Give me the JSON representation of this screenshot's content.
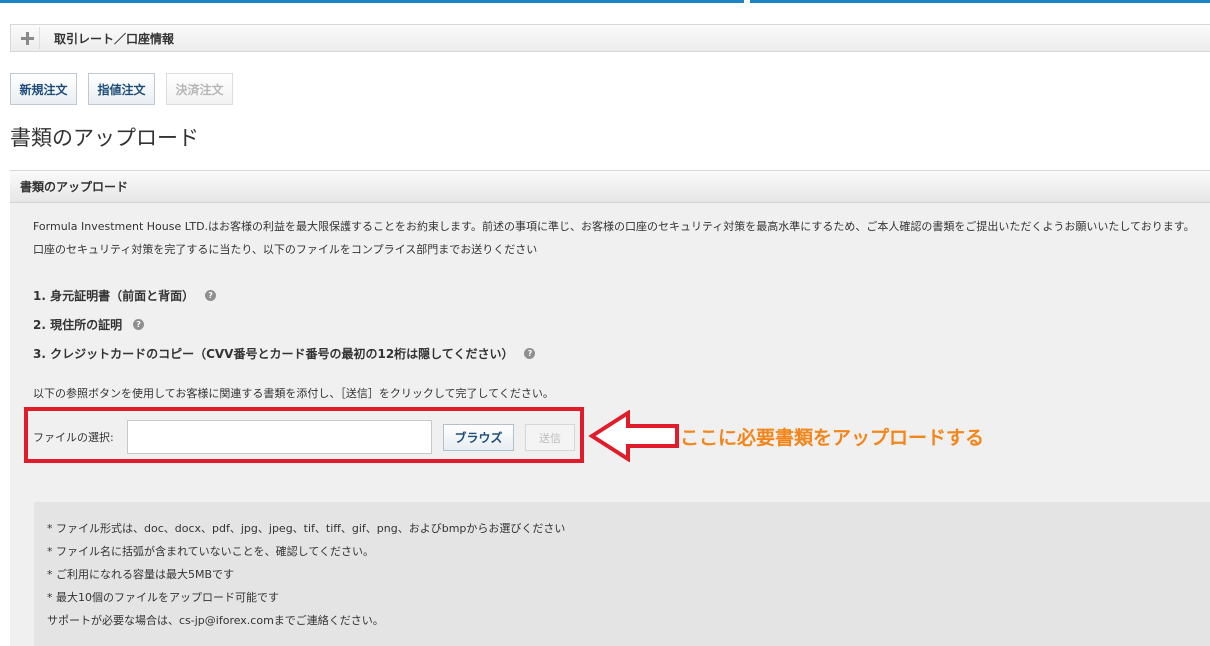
{
  "header": {
    "rate_bar_title": "取引レート／口座情報",
    "plus_icon": "plus-icon"
  },
  "order_tabs": [
    {
      "label": "新規注文",
      "enabled": true
    },
    {
      "label": "指値注文",
      "enabled": true
    },
    {
      "label": "決済注文",
      "enabled": false
    }
  ],
  "page": {
    "title": "書類のアップロード"
  },
  "panel": {
    "header": "書類のアップロード",
    "intro_line1": "Formula Investment House LTD.はお客様の利益を最大限保護することをお約束します。前述の事項に準じ、お客様の口座のセキュリティ対策を最高水準にするため、ご本人確認の書類をご提出いただくようお願いいたしております。",
    "intro_line2": "口座のセキュリティ対策を完了するに当たり、以下のファイルをコンプライス部門までお送りください",
    "requirements": [
      "1. 身元証明書（前面と背面）",
      "2. 現住所の証明",
      "3. クレジットカードのコピー（CVV番号とカード番号の最初の12桁は隠してください）"
    ],
    "help_icon": "?",
    "instruction": "以下の参照ボタンを使用してお客様に関連する書類を添付し、［送信］をクリックして完了してください。"
  },
  "upload": {
    "file_label": "ファイルの選択:",
    "file_value": "",
    "browse_label": "ブラウズ",
    "send_label": "送信"
  },
  "annotation": {
    "callout_text": "ここに必要書類をアップロードする",
    "highlight_color": "#e11c2a",
    "callout_color": "#f2861a"
  },
  "notes": [
    "* ファイル形式は、doc、docx、pdf、jpg、jpeg、tif、tiff、gif、png、およびbmpからお選びください",
    "* ファイル名に括弧が含まれていないことを、確認してください。",
    "* ご利用になれる容量は最大5MBです",
    "* 最大10個のファイルをアップロード可能です",
    "サポートが必要な場合は、cs-jp@iforex.comまでご連絡ください。"
  ],
  "colors": {
    "accent": "#1a84c7",
    "link_text": "#1e4d7a"
  }
}
